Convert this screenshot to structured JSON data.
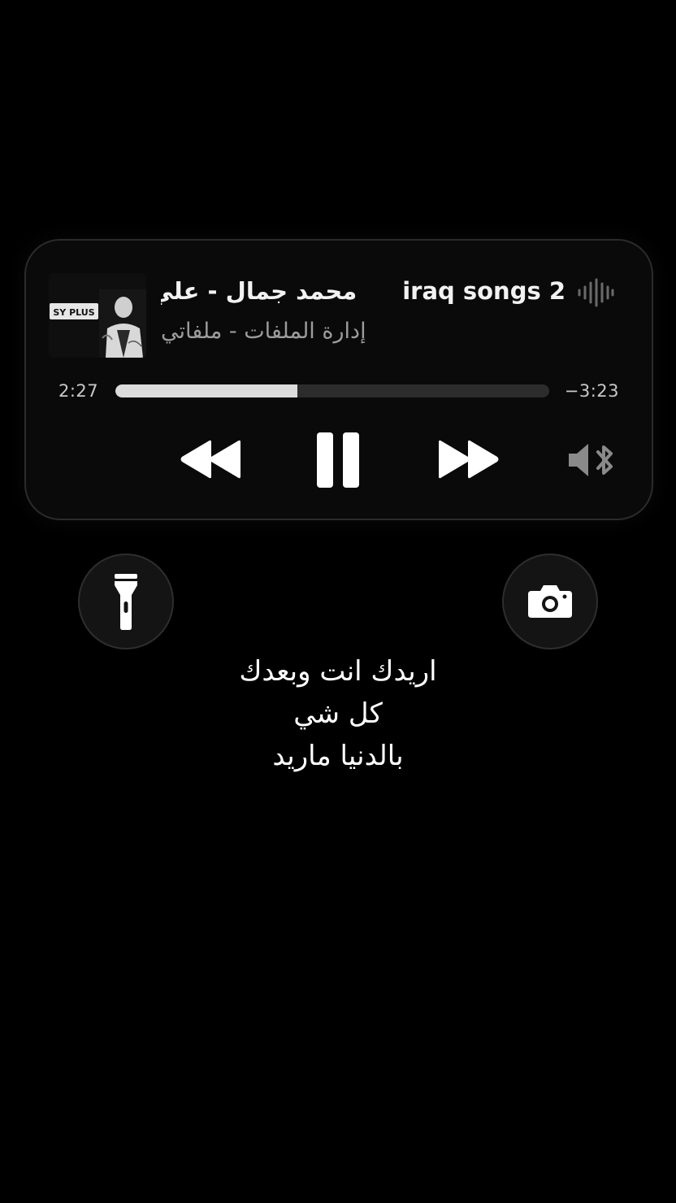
{
  "now_playing": {
    "title_primary": "محمد جمال - علي",
    "title_secondary": "iraq songs 2",
    "subtitle": "إدارة الملفات - ملفاتي",
    "artwork": {
      "logo_text": "SY PLUS"
    },
    "time_elapsed": "2:27",
    "time_remaining": "−3:23",
    "progress_fraction": 0.42,
    "controls": {
      "rewind_icon": "rewind-icon",
      "pause_icon": "pause-icon",
      "forward_icon": "fast-forward-icon",
      "airplay_icon": "speaker-bluetooth-icon",
      "waveform_icon": "waveform-icon"
    }
  },
  "quick_actions": {
    "flashlight_icon": "flashlight-icon",
    "camera_icon": "camera-icon"
  },
  "lyrics": {
    "lines": [
      "اريدك انت وبعدك",
      "كل شي",
      "بالدنيا ماريد"
    ]
  },
  "colors": {
    "background": "#000000",
    "widget_background": "#0a0a0a",
    "progress_fill": "#dcdcdc",
    "progress_track": "#2c2c2c",
    "secondary_text": "#9c9c9c"
  }
}
